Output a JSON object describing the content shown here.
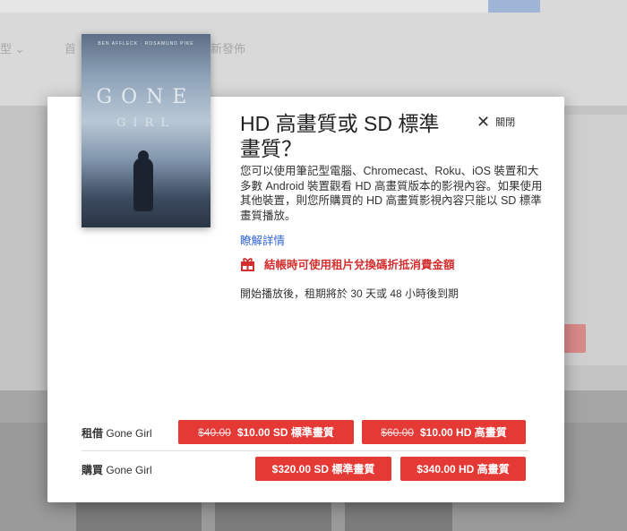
{
  "background": {
    "nav_items": [
      "型 ⌄",
      "首",
      "新發佈"
    ]
  },
  "dialog": {
    "poster": {
      "credits": "BEN AFFLECK · ROSAMUND PIKE",
      "title_line1": "GONE",
      "title_line2": "GIRL"
    },
    "title": "HD 高畫質或 SD 標準畫質？",
    "close_label": "關閉",
    "description": "您可以使用筆記型電腦、Chromecast、Roku、iOS 裝置和大多數 Android 裝置觀看 HD 高畫質版本的影視內容。如果使用其他裝置，則您所購買的 HD 高畫質影視內容只能以 SD 標準畫質播放。",
    "learn_more": "瞭解詳情",
    "promo": "結帳時可使用租片兌換碼折抵消費金額",
    "rental_note": "開始播放後，租期將於 30 天或 48 小時後到期",
    "rent": {
      "label_bold": "租借",
      "label_title": "Gone Girl",
      "sd": {
        "old_price": "$40.00",
        "price": "$10.00 SD 標準畫質"
      },
      "hd": {
        "old_price": "$60.00",
        "price": "$10.00 HD 高畫質"
      }
    },
    "buy": {
      "label_bold": "購買",
      "label_title": "Gone Girl",
      "sd": {
        "price": "$320.00 SD 標準畫質"
      },
      "hd": {
        "price": "$340.00 HD 高畫質"
      }
    }
  },
  "colors": {
    "accent_red": "#e53935",
    "link_blue": "#3367d6"
  }
}
